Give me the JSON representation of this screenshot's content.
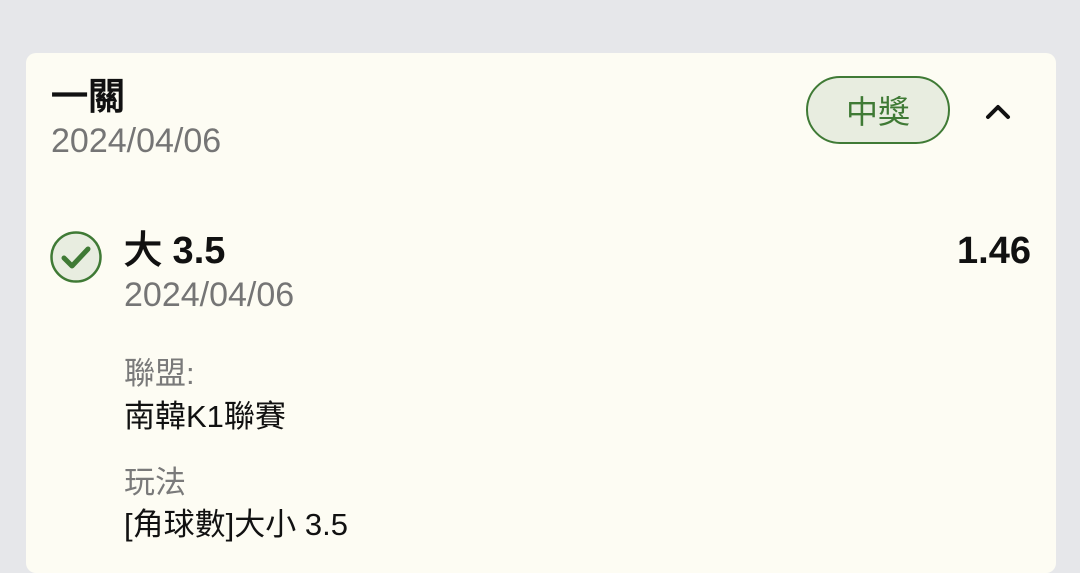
{
  "header": {
    "title": "一關",
    "date": "2024/04/06",
    "status_badge": "中獎",
    "collapse_icon": "chevron-up-icon"
  },
  "selection": {
    "status_icon": "check-circle-icon",
    "status_color": "#3f7a35",
    "name": "大 3.5",
    "odds": "1.46",
    "date": "2024/04/06",
    "league_label": "聯盟:",
    "league_value": "南韓K1聯賽",
    "market_label": "玩法",
    "market_value": "[角球數]大小 3.5"
  },
  "colors": {
    "background": "#e6e7ea",
    "card": "#fdfcf3",
    "accent_green": "#3f7a35",
    "badge_fill": "#e8ede0"
  }
}
